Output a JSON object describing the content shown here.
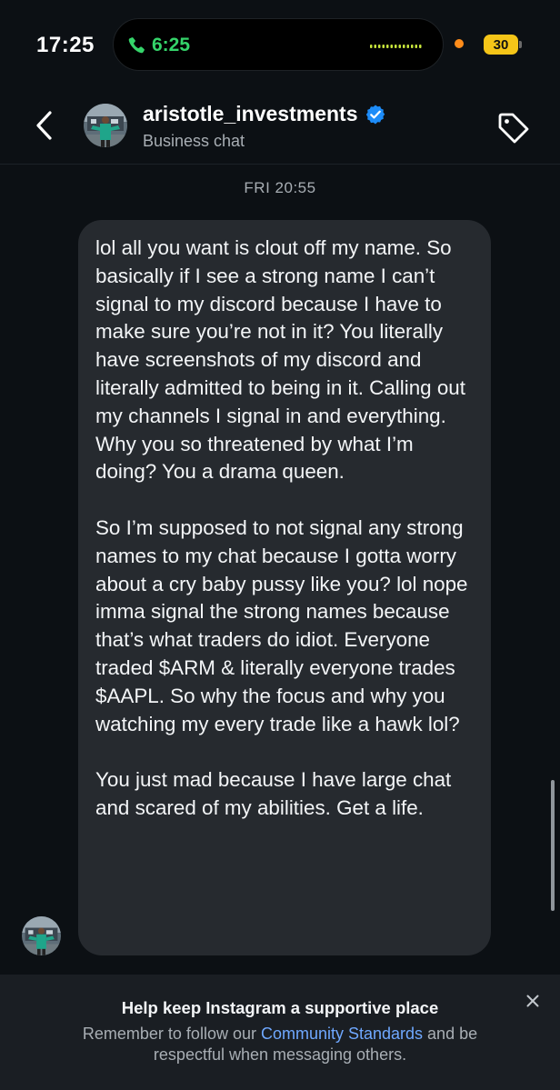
{
  "status_bar": {
    "time": "17:25",
    "call_duration": "6:25",
    "battery_level": "30",
    "colors": {
      "call": "#35d46a",
      "battery": "#f5c518",
      "recording": "#ff8c1a"
    }
  },
  "header": {
    "contact_name": "aristotle_investments",
    "subtitle": "Business chat",
    "verified": true,
    "icons": [
      "back-chevron-icon",
      "verified-badge-icon",
      "tag-icon"
    ]
  },
  "chat": {
    "timestamp": "FRI 20:55",
    "message": {
      "paragraphs": [
        "lol all you want is clout off my name. So basically if I see a strong name I can’t signal to my discord because I have to make sure you’re not in it? You literally have screenshots of my discord and literally admitted to being in it. Calling out my channels I signal in and everything. Why you so threatened by what I’m doing? You a drama queen.",
        "So I’m supposed to not signal any strong names to my chat because I gotta worry about a cry baby pussy like you? lol nope imma signal the strong names because that’s what traders do idiot. Everyone traded $ARM & literally everyone trades $AAPL. So why the focus and why you watching my every trade like a hawk lol?",
        "You just mad because I have large chat and scared of my abilities. Get a life."
      ]
    }
  },
  "notice": {
    "title": "Help keep Instagram a supportive place",
    "body_before": "Remember to follow our ",
    "link_text": "Community Standards",
    "body_after": " and be respectful when messaging others.",
    "link_color": "#6fa8ff"
  }
}
